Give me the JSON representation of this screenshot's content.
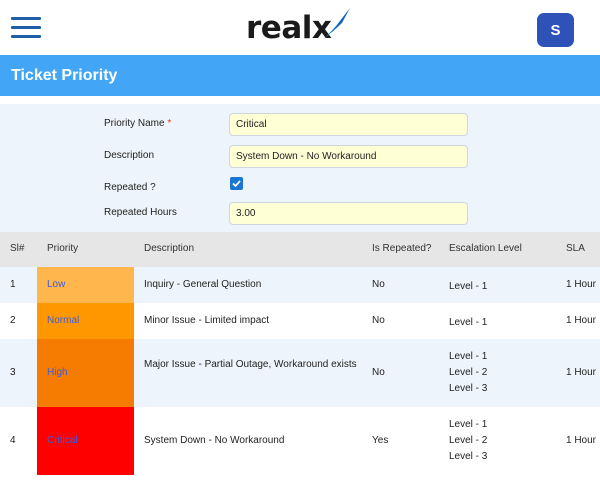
{
  "header": {
    "logo_text": "realx",
    "avatar_initial": "S"
  },
  "page": {
    "title": "Ticket Priority"
  },
  "form": {
    "priority_name_label": "Priority Name",
    "required_marker": "*",
    "priority_name_value": "Critical",
    "description_label": "Description",
    "description_value": "System Down - No Workaround",
    "repeated_label": "Repeated ?",
    "repeated_checked": true,
    "repeated_hours_label": "Repeated Hours",
    "repeated_hours_value": "3.00"
  },
  "table": {
    "columns": [
      "Sl#",
      "Priority",
      "Description",
      "Is Repeated?",
      "Escalation Level",
      "SLA"
    ],
    "rows": [
      {
        "sl": "1",
        "priority": "Low",
        "color": "#ffb74d",
        "description": "Inquiry - General Question",
        "repeated": "No",
        "escalation": [
          "Level - 1"
        ],
        "sla": "1 Hour"
      },
      {
        "sl": "2",
        "priority": "Normal",
        "color": "#ff9800",
        "description": "Minor Issue - Limited impact",
        "repeated": "No",
        "escalation": [
          "Level - 1"
        ],
        "sla": "1 Hour"
      },
      {
        "sl": "3",
        "priority": "High",
        "color": "#f57c00",
        "description": "Major Issue - Partial Outage, Workaround exists",
        "repeated": "No",
        "escalation": [
          "Level - 1",
          "Level - 2",
          "Level - 3"
        ],
        "sla": "1 Hour"
      },
      {
        "sl": "4",
        "priority": "Critical",
        "color": "#ff0000",
        "description": "System Down - No Workaround",
        "repeated": "Yes",
        "escalation": [
          "Level - 1",
          "Level - 2",
          "Level - 3"
        ],
        "sla": "1 Hour"
      }
    ]
  },
  "colors": {
    "brand_blue": "#42a5f5",
    "avatar_blue": "#2f52b8",
    "input_bg": "#ffffd6"
  },
  "icons": {
    "menu": "hamburger-menu-icon",
    "checkbox": "check-icon"
  }
}
